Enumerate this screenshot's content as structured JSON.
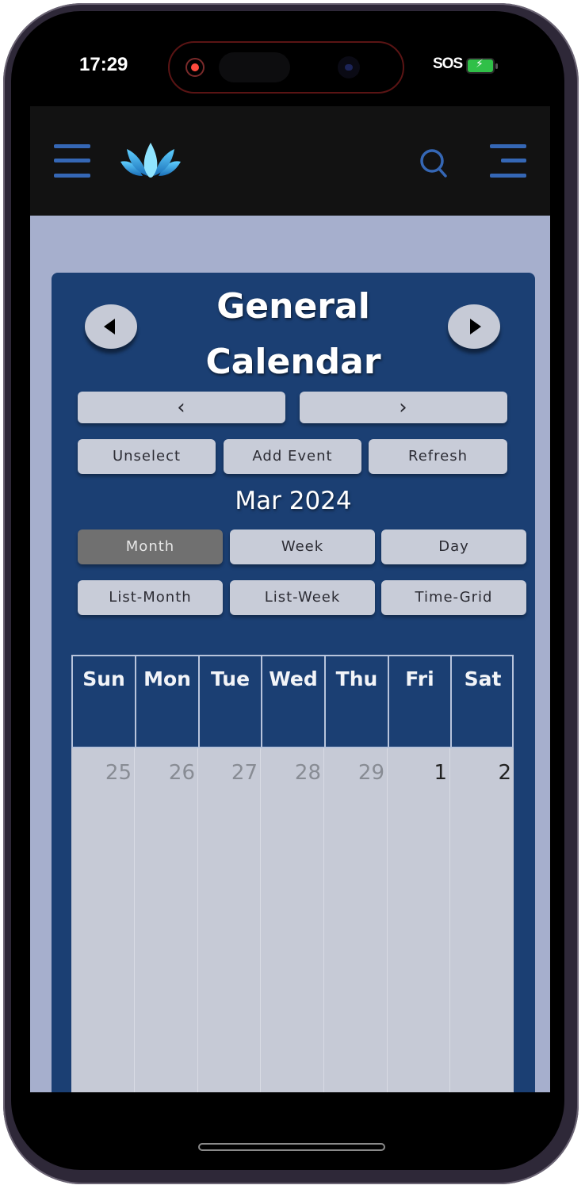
{
  "status_bar": {
    "time": "17:29",
    "carrier": "SOS",
    "battery_state": "charging"
  },
  "navbar": {
    "left_menu_icon": "hamburger-menu-icon",
    "logo_icon": "lotus-logo-icon",
    "search_icon": "search-icon",
    "right_menu_icon": "menu-right-aligned-icon"
  },
  "calendar": {
    "title_line1": "General",
    "title_line2": "Calendar",
    "prev_round_icon": "triangle-left-icon",
    "next_round_icon": "triangle-right-icon",
    "prev_label": "‹",
    "next_label": "›",
    "actions": [
      "Unselect",
      "Add Event",
      "Refresh"
    ],
    "month_label": "Mar 2024",
    "views": [
      "Month",
      "Week",
      "Day",
      "List-Month",
      "List-Week",
      "Time-Grid"
    ],
    "active_view": "Month",
    "weekdays": [
      "Sun",
      "Mon",
      "Tue",
      "Wed",
      "Thu",
      "Fri",
      "Sat"
    ],
    "first_week": [
      {
        "day": "25",
        "in_month": false
      },
      {
        "day": "26",
        "in_month": false
      },
      {
        "day": "27",
        "in_month": false
      },
      {
        "day": "28",
        "in_month": false
      },
      {
        "day": "29",
        "in_month": false
      },
      {
        "day": "1",
        "in_month": true
      },
      {
        "day": "2",
        "in_month": true
      }
    ]
  },
  "colors": {
    "navbar_bg": "#121212",
    "accent_blue": "#3567b5",
    "card_bg": "#1b3f73",
    "page_bg": "#a6afcd",
    "button_bg": "#c8ccd8",
    "active_button_bg": "#707070"
  }
}
